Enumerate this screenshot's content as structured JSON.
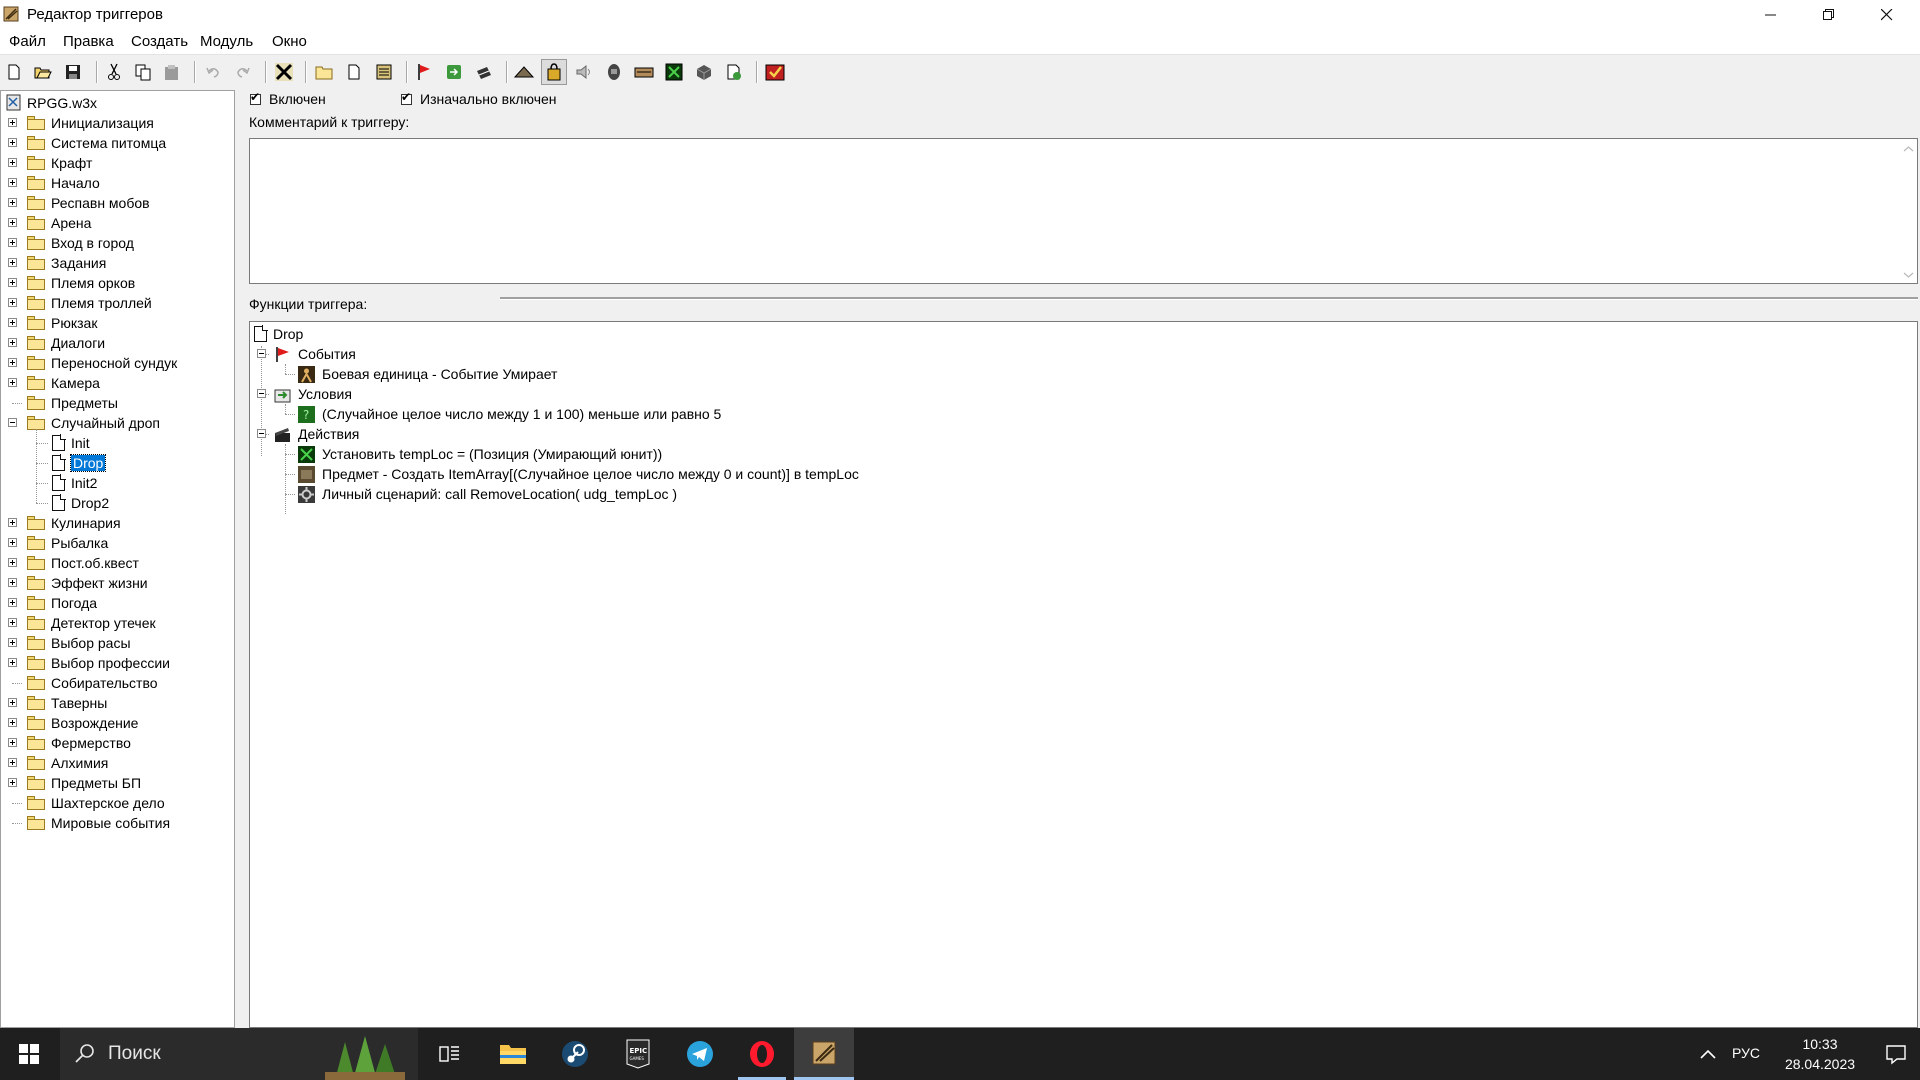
{
  "window": {
    "title": "Редактор триггеров"
  },
  "menu": [
    "Файл",
    "Правка",
    "Создать",
    "Модуль",
    "Окно"
  ],
  "toolbar": {
    "buttons": [
      "new-icon",
      "open-icon",
      "save-icon",
      "cut-icon",
      "copy-icon",
      "paste-icon",
      "undo-icon",
      "redo-icon",
      "terrain-editor-icon",
      "new-category-icon",
      "new-trigger-icon",
      "new-comment-icon",
      "new-event-icon",
      "new-condition-icon",
      "new-action-icon",
      "unit-editor-icon",
      "trigger-editor-icon",
      "sound-editor-icon",
      "object-editor-icon",
      "campaign-editor-icon",
      "ai-editor-icon",
      "object-manager-icon",
      "import-manager-icon",
      "test-map-icon"
    ],
    "pressed": "trigger-editor-icon"
  },
  "tree": {
    "root": "RPGG.w3x",
    "items": [
      {
        "label": "Инициализация",
        "expander": "plus",
        "level": 0
      },
      {
        "label": "Система питомца",
        "expander": "plus",
        "level": 0
      },
      {
        "label": "Крафт",
        "expander": "plus",
        "level": 0
      },
      {
        "label": "Начало",
        "expander": "plus",
        "level": 0
      },
      {
        "label": "Респавн мобов",
        "expander": "plus",
        "level": 0
      },
      {
        "label": "Арена",
        "expander": "plus",
        "level": 0
      },
      {
        "label": "Вход в город",
        "expander": "plus",
        "level": 0
      },
      {
        "label": "Задания",
        "expander": "plus",
        "level": 0
      },
      {
        "label": "Племя орков",
        "expander": "plus",
        "level": 0
      },
      {
        "label": "Племя троллей",
        "expander": "plus",
        "level": 0
      },
      {
        "label": "Рюкзак",
        "expander": "plus",
        "level": 0
      },
      {
        "label": "Диалоги",
        "expander": "plus",
        "level": 0
      },
      {
        "label": "Переносной сундук",
        "expander": "plus",
        "level": 0
      },
      {
        "label": "Камера",
        "expander": "plus",
        "level": 0
      },
      {
        "label": "Предметы",
        "expander": "none",
        "level": 0
      },
      {
        "label": "Случайный дроп",
        "expander": "minus",
        "level": 0,
        "open": true
      },
      {
        "label": "Init",
        "expander": "none",
        "level": 1,
        "type": "trigger"
      },
      {
        "label": "Drop",
        "expander": "none",
        "level": 1,
        "type": "trigger",
        "selected": true
      },
      {
        "label": "Init2",
        "expander": "none",
        "level": 1,
        "type": "trigger"
      },
      {
        "label": "Drop2",
        "expander": "none",
        "level": 1,
        "type": "trigger"
      },
      {
        "label": "Кулинария",
        "expander": "plus",
        "level": 0
      },
      {
        "label": "Рыбалка",
        "expander": "plus",
        "level": 0
      },
      {
        "label": "Пост.об.квест",
        "expander": "plus",
        "level": 0
      },
      {
        "label": "Эффект жизни",
        "expander": "plus",
        "level": 0
      },
      {
        "label": "Погода",
        "expander": "plus",
        "level": 0
      },
      {
        "label": "Детектор утечек",
        "expander": "plus",
        "level": 0
      },
      {
        "label": "Выбор расы",
        "expander": "plus",
        "level": 0
      },
      {
        "label": "Выбор профессии",
        "expander": "plus",
        "level": 0
      },
      {
        "label": "Собирательство",
        "expander": "none",
        "level": 0
      },
      {
        "label": "Таверны",
        "expander": "plus",
        "level": 0
      },
      {
        "label": "Возрождение",
        "expander": "plus",
        "level": 0
      },
      {
        "label": "Фермерство",
        "expander": "plus",
        "level": 0
      },
      {
        "label": "Алхимия",
        "expander": "plus",
        "level": 0
      },
      {
        "label": "Предметы БП",
        "expander": "plus",
        "level": 0
      },
      {
        "label": "Шахтерское дело",
        "expander": "none",
        "level": 0
      },
      {
        "label": "Мировые события",
        "expander": "none",
        "level": 0
      }
    ]
  },
  "trigger": {
    "enabled_label": "Включен",
    "enabled": true,
    "initially_on_label": "Изначально включен",
    "initially_on": true,
    "comment_label": "Комментарий к триггеру:",
    "comment": "",
    "functions_label": "Функции триггера:",
    "name": "Drop",
    "events_label": "События",
    "events": [
      "Боевая единица - Событие Умирает"
    ],
    "conditions_label": "Условия",
    "conditions": [
      "(Случайное целое число между 1 и 100) меньше или равно 5"
    ],
    "actions_label": "Действия",
    "actions": [
      {
        "icon": "set-variable-icon",
        "text": "Установить tempLoc = (Позиция (Умирающий юнит))"
      },
      {
        "icon": "create-item-icon",
        "text": "Предмет - Создать ItemArray[(Случайное целое число между 0 и count)] в tempLoc"
      },
      {
        "icon": "custom-script-icon",
        "text": "Личный сценарий:   call RemoveLocation( udg_tempLoc )"
      }
    ]
  },
  "taskbar": {
    "search_placeholder": "Поиск",
    "apps": [
      "task-view-icon",
      "file-explorer-icon",
      "steam-icon",
      "epic-games-icon",
      "telegram-icon",
      "opera-icon",
      "world-editor-icon"
    ],
    "active_app": "world-editor-icon",
    "language": "РУС",
    "time": "10:33",
    "date": "28.04.2023",
    "colors": {
      "taskbar_bg": "#1f1f1f",
      "selection": "#0078d7",
      "opera": "#ff1b2d",
      "telegram": "#2aa3dd"
    }
  }
}
